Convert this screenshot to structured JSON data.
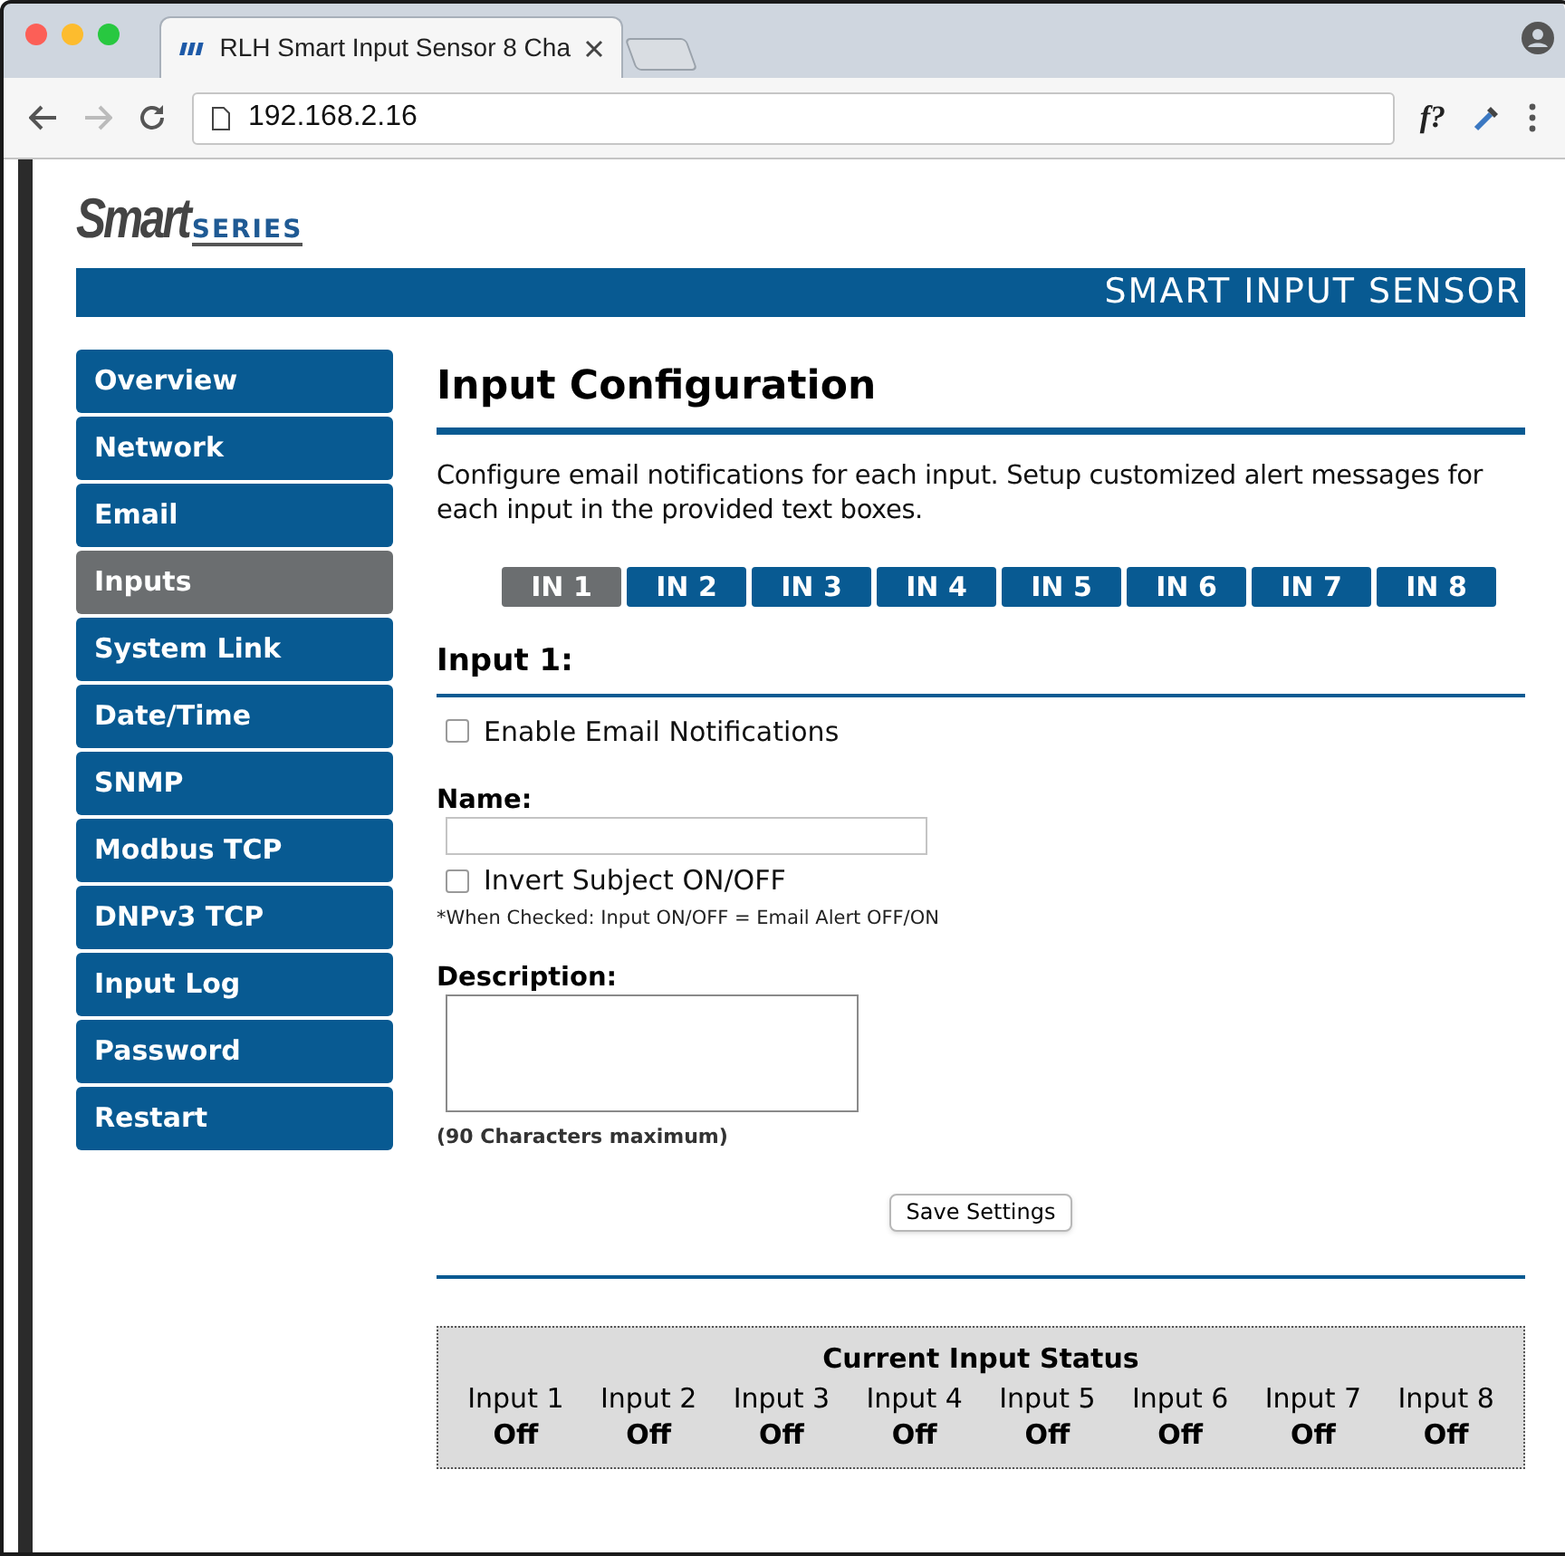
{
  "browser": {
    "tab_title": "RLH Smart Input Sensor 8 Cha",
    "url": "192.168.2.16",
    "toolbar_text": "f?"
  },
  "logo": {
    "main": "Smart",
    "sub": "SERIES"
  },
  "banner": "SMART INPUT SENSOR",
  "sidebar": {
    "items": [
      {
        "label": "Overview",
        "selected": false
      },
      {
        "label": "Network",
        "selected": false
      },
      {
        "label": "Email",
        "selected": false
      },
      {
        "label": "Inputs",
        "selected": true
      },
      {
        "label": "System Link",
        "selected": false
      },
      {
        "label": "Date/Time",
        "selected": false
      },
      {
        "label": "SNMP",
        "selected": false
      },
      {
        "label": "Modbus TCP",
        "selected": false
      },
      {
        "label": "DNPv3 TCP",
        "selected": false
      },
      {
        "label": "Input Log",
        "selected": false
      },
      {
        "label": "Password",
        "selected": false
      },
      {
        "label": "Restart",
        "selected": false
      }
    ]
  },
  "main": {
    "title": "Input Configuration",
    "intro": "Configure email notifications for each input. Setup customized alert messages for each input in the provided text boxes.",
    "tabs": [
      {
        "label": "IN 1",
        "selected": true
      },
      {
        "label": "IN 2",
        "selected": false
      },
      {
        "label": "IN 3",
        "selected": false
      },
      {
        "label": "IN 4",
        "selected": false
      },
      {
        "label": "IN 5",
        "selected": false
      },
      {
        "label": "IN 6",
        "selected": false
      },
      {
        "label": "IN 7",
        "selected": false
      },
      {
        "label": "IN 8",
        "selected": false
      }
    ],
    "section_title": "Input 1:",
    "enable_email": {
      "label": "Enable Email Notifications",
      "checked": false
    },
    "name_label": "Name:",
    "invert": {
      "label": "Invert Subject ON/OFF",
      "checked": false
    },
    "invert_note": "*When Checked: Input ON/OFF = Email Alert OFF/ON",
    "description_label": "Description:",
    "description_note": "(90 Characters maximum)",
    "save_button": "Save Settings"
  },
  "status": {
    "title": "Current Input Status",
    "inputs": [
      {
        "name": "Input 1",
        "value": "Off"
      },
      {
        "name": "Input 2",
        "value": "Off"
      },
      {
        "name": "Input 3",
        "value": "Off"
      },
      {
        "name": "Input 4",
        "value": "Off"
      },
      {
        "name": "Input 5",
        "value": "Off"
      },
      {
        "name": "Input 6",
        "value": "Off"
      },
      {
        "name": "Input 7",
        "value": "Off"
      },
      {
        "name": "Input 8",
        "value": "Off"
      }
    ]
  }
}
